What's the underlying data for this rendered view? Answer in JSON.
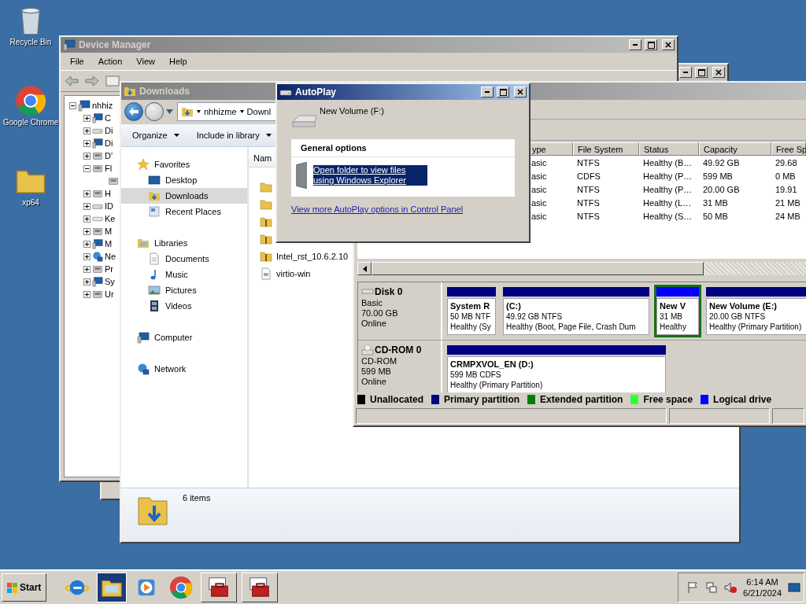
{
  "desktop_icons": [
    {
      "label": "Recycle Bin",
      "kind": "bin"
    },
    {
      "label": "Google Chrome",
      "kind": "chrome"
    },
    {
      "label": "xp64",
      "kind": "folder"
    }
  ],
  "device_manager": {
    "title": "Device Manager",
    "menu": [
      "File",
      "Action",
      "View",
      "Help"
    ],
    "tree": {
      "label": "nhhiz",
      "expanded": true,
      "children": [
        {
          "label": "C",
          "kind": "computer",
          "expanded": false
        },
        {
          "label": "Di",
          "kind": "drive",
          "expanded": false
        },
        {
          "label": "Di",
          "kind": "computer",
          "expanded": false
        },
        {
          "label": "D'",
          "kind": "device",
          "expanded": false
        },
        {
          "label": "Fl",
          "kind": "device",
          "expanded": true,
          "children": [
            {
              "kind": "device"
            }
          ]
        },
        {
          "label": "H",
          "kind": "device",
          "expanded": false
        },
        {
          "label": "ID",
          "kind": "drive",
          "expanded": false
        },
        {
          "label": "Ke",
          "kind": "keyboard",
          "expanded": false
        },
        {
          "label": "M",
          "kind": "device",
          "expanded": false
        },
        {
          "label": "M",
          "kind": "computer",
          "expanded": false
        },
        {
          "label": "Ne",
          "kind": "network",
          "expanded": false
        },
        {
          "label": "Pr",
          "kind": "device",
          "expanded": false
        },
        {
          "label": "Sy",
          "kind": "computer",
          "expanded": false
        },
        {
          "label": "Ur",
          "kind": "device",
          "expanded": false
        }
      ]
    }
  },
  "downloads": {
    "title": "Downloads",
    "breadcrumb": [
      "nhhizme",
      "Downl"
    ],
    "toolbar": [
      "Organize",
      "Include in library"
    ],
    "nav": [
      {
        "label": "Favorites",
        "kind": "star",
        "items": [
          {
            "label": "Desktop",
            "kind": "desktop",
            "selected": false
          },
          {
            "label": "Downloads",
            "kind": "downloads",
            "selected": true
          },
          {
            "label": "Recent Places",
            "kind": "recent",
            "selected": false
          }
        ]
      },
      {
        "label": "Libraries",
        "kind": "libraries",
        "items": [
          {
            "label": "Documents",
            "kind": "docs",
            "selected": false
          },
          {
            "label": "Music",
            "kind": "music",
            "selected": false
          },
          {
            "label": "Pictures",
            "kind": "pictures",
            "selected": false
          },
          {
            "label": "Videos",
            "kind": "videos",
            "selected": false
          }
        ]
      },
      {
        "label": "Computer",
        "kind": "computer"
      },
      {
        "label": "Network",
        "kind": "network"
      }
    ],
    "list_header": "Nam",
    "files": [
      {
        "kind": "folder"
      },
      {
        "kind": "folder"
      },
      {
        "kind": "zip"
      },
      {
        "kind": "zip"
      },
      {
        "kind": "zip",
        "name": "Intel_rst_10.6.2.10"
      },
      {
        "kind": "file",
        "name": "virtio-win"
      }
    ],
    "status": "6 items"
  },
  "disk_management": {
    "table": {
      "columns": [
        "ype",
        "File System",
        "Status",
        "Capacity",
        "Free Sp"
      ],
      "rows": [
        [
          "asic",
          "NTFS",
          "Healthy (B…",
          "49.92 GB",
          "29.68"
        ],
        [
          "asic",
          "CDFS",
          "Healthy (P…",
          "599 MB",
          "0 MB"
        ],
        [
          "asic",
          "NTFS",
          "Healthy (P…",
          "20.00 GB",
          "19.91"
        ],
        [
          "asic",
          "NTFS",
          "Healthy (L…",
          "31 MB",
          "21 MB"
        ],
        [
          "asic",
          "NTFS",
          "Healthy (S…",
          "50 MB",
          "24 MB"
        ]
      ]
    },
    "disks": [
      {
        "name": "Disk 0",
        "kind": "disk",
        "details": [
          "Basic",
          "70.00 GB",
          "Online"
        ],
        "partitions": [
          {
            "kind": "primary",
            "name": "System R",
            "lines": [
              "50 MB NTF",
              "Healthy (Sy"
            ],
            "selected": false
          },
          {
            "kind": "primary",
            "name": "(C:)",
            "lines": [
              "49.92 GB NTFS",
              "Healthy (Boot, Page File, Crash Dum"
            ],
            "selected": false
          },
          {
            "kind": "logical",
            "name": "New V",
            "lines": [
              "31 MB",
              "Healthy"
            ],
            "selected": true
          },
          {
            "kind": "primary",
            "name": "New Volume  (E:)",
            "lines": [
              "20.00 GB NTFS",
              "Healthy (Primary Partition)"
            ],
            "selected": false
          }
        ]
      },
      {
        "name": "CD-ROM 0",
        "kind": "cdrom",
        "details": [
          "CD-ROM",
          "599 MB",
          "Online"
        ],
        "partitions": [
          {
            "kind": "primary",
            "name": "CRMPXVOL_EN  (D:)",
            "lines": [
              "599 MB CDFS",
              "Healthy (Primary Partition)"
            ],
            "selected": false
          }
        ]
      }
    ],
    "legend": [
      {
        "label": "Unallocated",
        "color": "#000000"
      },
      {
        "label": "Primary partition",
        "color": "#000080"
      },
      {
        "label": "Extended partition",
        "color": "#008000"
      },
      {
        "label": "Free space",
        "color": "#33ff33"
      },
      {
        "label": "Logical drive",
        "color": "#0000ff"
      }
    ]
  },
  "autoplay": {
    "title": "AutoPlay",
    "device": "New Volume (F:)",
    "section": "General options",
    "options": [
      {
        "label": "Open folder to view files using Windows Explorer",
        "selected": true
      }
    ],
    "link": "View more AutoPlay options in Control Panel"
  },
  "taskbar": {
    "start": "Start",
    "apps": [
      {
        "kind": "ie",
        "selected": false
      },
      {
        "kind": "explorer",
        "selected": true
      },
      {
        "kind": "media",
        "selected": false
      },
      {
        "kind": "chrome",
        "selected": false
      },
      {
        "kind": "toolbox",
        "selected": false
      },
      {
        "kind": "toolbox",
        "selected": false
      }
    ],
    "volume_muted": true,
    "time": "6:14 AM",
    "date": "6/21/2024"
  }
}
